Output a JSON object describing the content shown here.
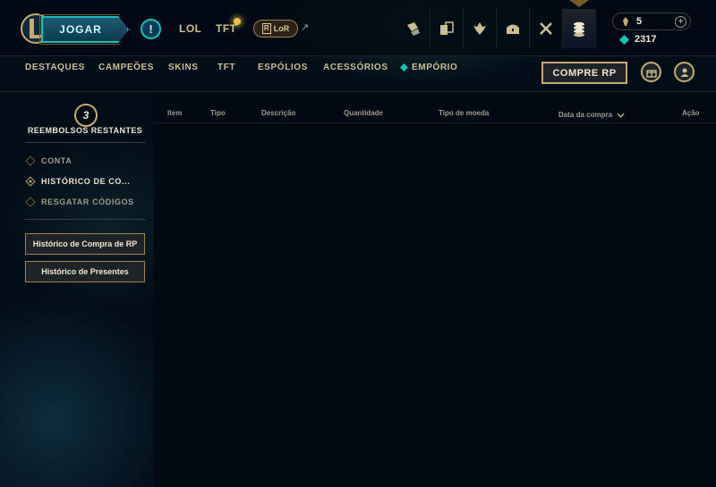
{
  "topbar": {
    "play_label": "JOGAR",
    "alert_label": "!",
    "games": [
      {
        "label": "LOL"
      },
      {
        "label": "TFT"
      }
    ],
    "lor_label": "LoR",
    "lor_mark": "R",
    "external_arrow": "↗",
    "nav_icons": [
      "profile-cards-icon",
      "collection-icon",
      "tft-icon",
      "loot-chest-icon",
      "clash-icon",
      "store-icon"
    ],
    "rp_amount": "5",
    "be_amount": "2317",
    "plus_label": "+"
  },
  "subnav": {
    "items": [
      "DESTAQUES",
      "CAMPEÕES",
      "SKINS",
      "TFT",
      "ESPÓLIOS",
      "ACESSÓRIOS",
      "EMPÓRIO"
    ],
    "buy_rp_label": "COMPRE RP"
  },
  "sidebar": {
    "refunds_count": "3",
    "refunds_label": "REEMBOLSOS RESTANTES",
    "menu": [
      {
        "label": "CONTA",
        "active": false
      },
      {
        "label": "HISTÓRICO DE CO...",
        "active": true
      },
      {
        "label": "RESGATAR CÓDIGOS",
        "active": false
      }
    ],
    "buttons": [
      {
        "label": "Histórico de Compra de RP"
      },
      {
        "label": "Histórico de Presentes"
      }
    ]
  },
  "table": {
    "columns": [
      "Item",
      "Tipo",
      "Descrição",
      "Quantidade",
      "Tipo de moeda",
      "Data da compra",
      "Ação"
    ],
    "sort_column": "Data da compra",
    "rows": []
  },
  "colors": {
    "gold": "#c8aa6e",
    "teal": "#0ac8b9",
    "background": "#010a13"
  }
}
